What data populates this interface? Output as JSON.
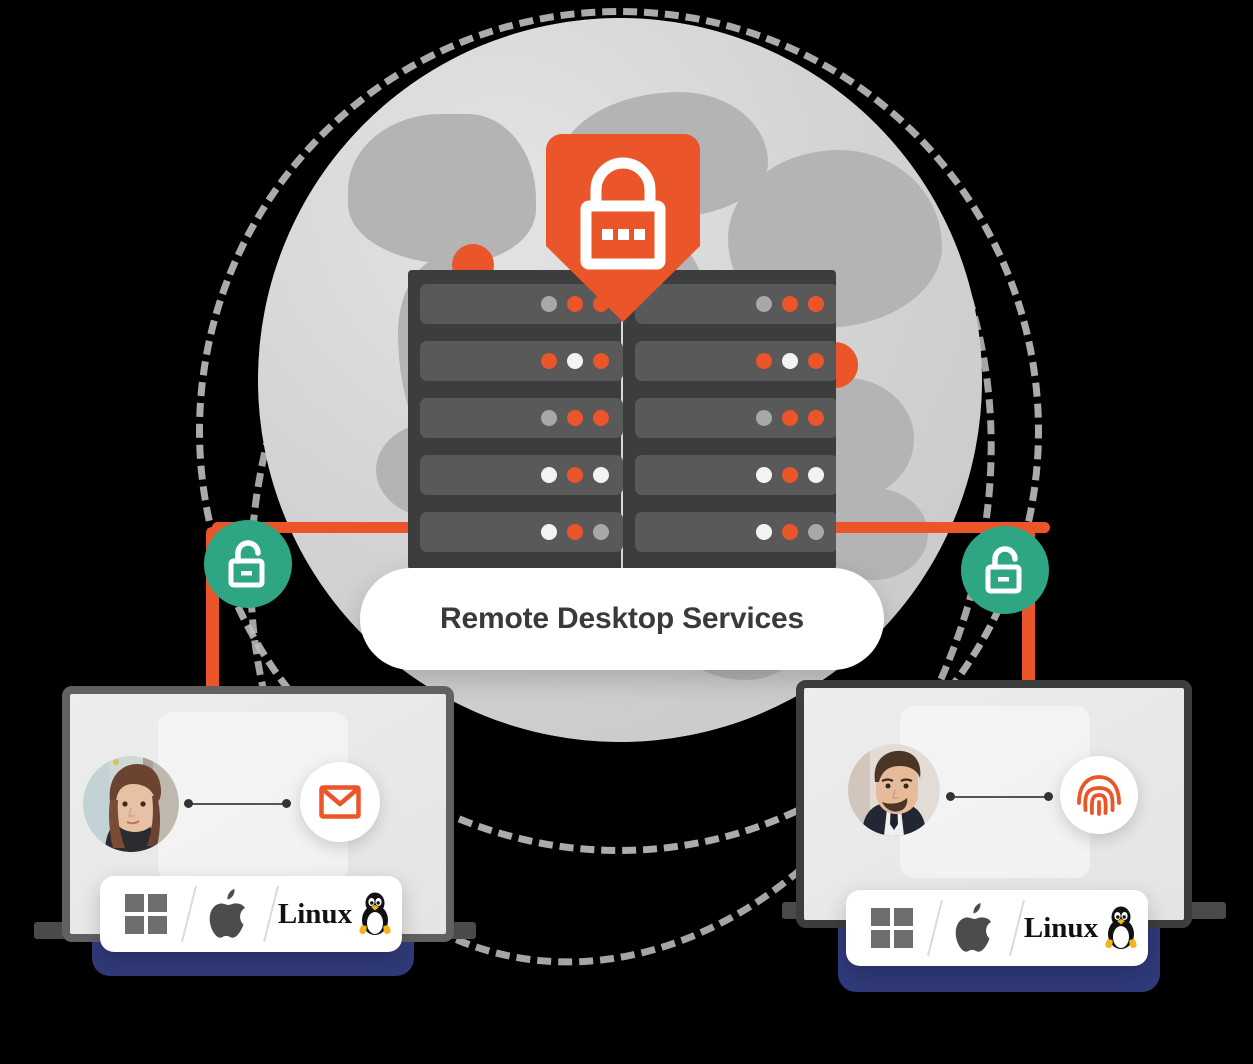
{
  "scene": {
    "title": "Remote Desktop Services",
    "center_label": "Remote Desktop Services",
    "colors": {
      "accent_orange": "#ea5529",
      "badge_green": "#2ea583",
      "rack_body": "#3d3d3d",
      "rack_slot": "#595959",
      "globe_base": "#d2d2d2",
      "globe_continent": "#b4b4b4",
      "laptop_bezel": "#616161",
      "laptop_shadow_navy": "#303a7a",
      "text_dark": "#3a3a3a",
      "led_grey": "#a8a8a8",
      "led_white": "#f3f3f3"
    }
  },
  "shield": {
    "icon": "shield-icon",
    "inner_icon": "padlock-icon",
    "lock_dots": 3,
    "color": "#ea5529"
  },
  "globe": {
    "icon": "globe-icon",
    "orbit_rings": 2,
    "orbit_style": "dashed",
    "accent_dots": 2
  },
  "server_rack": {
    "name": "server-rack",
    "columns": 2,
    "rows": 5,
    "led_rows": [
      [
        "grey",
        "orange",
        "orange"
      ],
      [
        "orange",
        "white",
        "orange"
      ],
      [
        "grey",
        "orange",
        "orange"
      ],
      [
        "white",
        "orange",
        "white"
      ],
      [
        "white",
        "orange",
        "grey"
      ]
    ]
  },
  "badges": [
    {
      "name": "unlock-badge-left",
      "icon": "open-padlock-icon",
      "color": "#2ea583"
    },
    {
      "name": "unlock-badge-right",
      "icon": "open-padlock-icon",
      "color": "#2ea583"
    }
  ],
  "endpoints": [
    {
      "name": "laptop-left",
      "user": {
        "name": "avatar-woman",
        "alt": "Woman user avatar"
      },
      "auth": {
        "icon": "email-icon",
        "label": "Email",
        "color": "#ea5529"
      },
      "os_bar": {
        "items": [
          {
            "icon": "windows-icon",
            "label": "Windows"
          },
          {
            "icon": "apple-icon",
            "label": "macOS"
          },
          {
            "icon": "linux-tux-icon",
            "label": "Linux"
          }
        ],
        "separator": "/",
        "linux_text": "Linux"
      }
    },
    {
      "name": "laptop-right",
      "user": {
        "name": "avatar-man",
        "alt": "Man user avatar"
      },
      "auth": {
        "icon": "fingerprint-icon",
        "label": "Fingerprint",
        "color": "#ea5529"
      },
      "os_bar": {
        "items": [
          {
            "icon": "windows-icon",
            "label": "Windows"
          },
          {
            "icon": "apple-icon",
            "label": "macOS"
          },
          {
            "icon": "linux-tux-icon",
            "label": "Linux"
          }
        ],
        "separator": "/",
        "linux_text": "Linux"
      }
    }
  ],
  "cables": {
    "name": "connection-cable",
    "color": "#ea5529",
    "count": 2
  }
}
